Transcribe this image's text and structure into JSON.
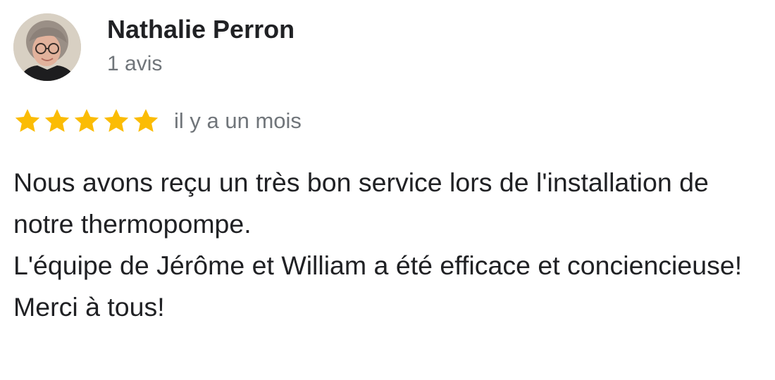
{
  "review": {
    "author": {
      "name": "Nathalie Perron",
      "review_count": "1 avis",
      "avatar_icon": "user-photo-avatar"
    },
    "rating": {
      "stars": 5,
      "max_stars": 5,
      "star_color": "#fbbc04",
      "star_icon": "star-icon"
    },
    "timestamp": "il y a un mois",
    "text_lines": [
      "Nous avons reçu un très bon service lors de l'installation de notre thermopompe.",
      "L'équipe de Jérôme et William a été efficace et conciencieuse!",
      "Merci à tous!"
    ]
  },
  "colors": {
    "name_text": "#202124",
    "secondary_text": "#70757a",
    "star_fill": "#fbbc04",
    "background": "#ffffff"
  }
}
